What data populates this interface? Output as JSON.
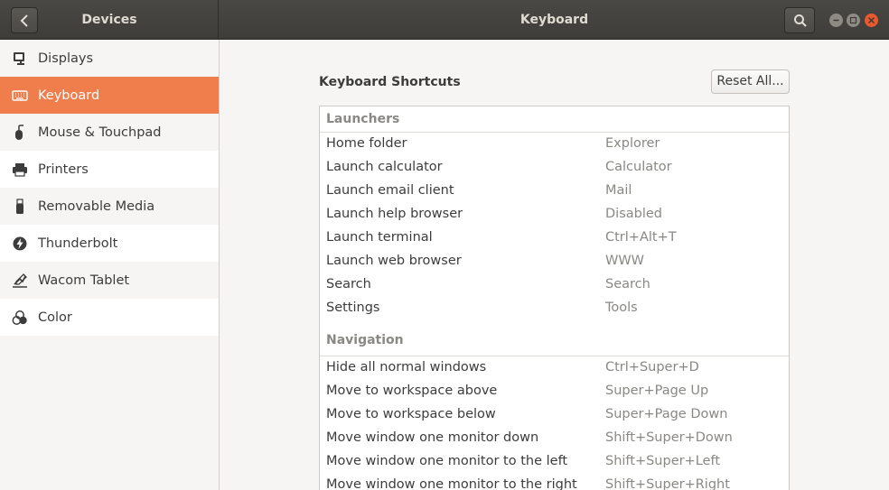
{
  "header": {
    "panel_title": "Devices",
    "main_title": "Keyboard"
  },
  "sidebar": {
    "items": [
      {
        "label": "Displays",
        "icon": "display-icon"
      },
      {
        "label": "Keyboard",
        "icon": "keyboard-icon",
        "active": true
      },
      {
        "label": "Mouse & Touchpad",
        "icon": "mouse-icon"
      },
      {
        "label": "Printers",
        "icon": "printer-icon"
      },
      {
        "label": "Removable Media",
        "icon": "usb-icon"
      },
      {
        "label": "Thunderbolt",
        "icon": "thunderbolt-icon"
      },
      {
        "label": "Wacom Tablet",
        "icon": "tablet-icon"
      },
      {
        "label": "Color",
        "icon": "color-icon"
      }
    ]
  },
  "main": {
    "section_title": "Keyboard Shortcuts",
    "reset_label": "Reset All...",
    "groups": [
      {
        "title": "Launchers",
        "rows": [
          {
            "name": "Home folder",
            "accel": "Explorer"
          },
          {
            "name": "Launch calculator",
            "accel": "Calculator"
          },
          {
            "name": "Launch email client",
            "accel": "Mail"
          },
          {
            "name": "Launch help browser",
            "accel": "Disabled"
          },
          {
            "name": "Launch terminal",
            "accel": "Ctrl+Alt+T"
          },
          {
            "name": "Launch web browser",
            "accel": "WWW"
          },
          {
            "name": "Search",
            "accel": "Search"
          },
          {
            "name": "Settings",
            "accel": "Tools"
          }
        ]
      },
      {
        "title": "Navigation",
        "rows": [
          {
            "name": "Hide all normal windows",
            "accel": "Ctrl+Super+D"
          },
          {
            "name": "Move to workspace above",
            "accel": "Super+Page Up"
          },
          {
            "name": "Move to workspace below",
            "accel": "Super+Page Down"
          },
          {
            "name": "Move window one monitor down",
            "accel": "Shift+Super+Down"
          },
          {
            "name": "Move window one monitor to the left",
            "accel": "Shift+Super+Left"
          },
          {
            "name": "Move window one monitor to the right",
            "accel": "Shift+Super+Right"
          }
        ]
      }
    ]
  },
  "colors": {
    "accent": "#f07d4c",
    "header": "#413f3b",
    "close": "#e9592d"
  }
}
